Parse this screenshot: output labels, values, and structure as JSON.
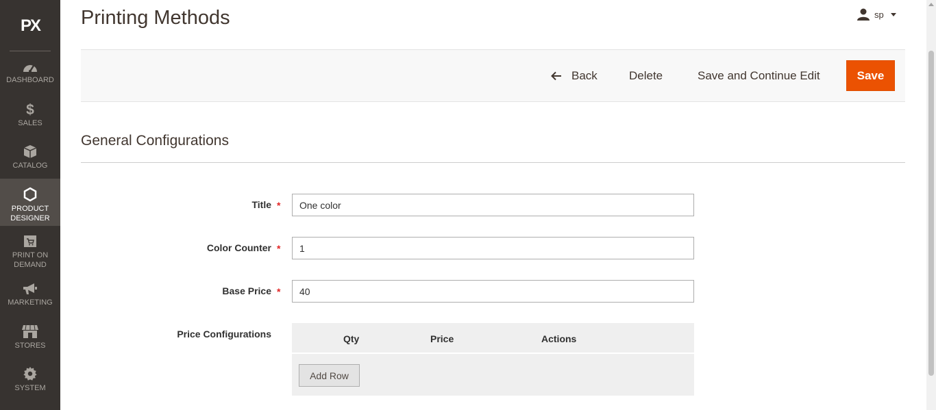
{
  "sidebar": {
    "logo": "PX",
    "items": [
      {
        "label": "DASHBOARD",
        "icon": "gauge-icon"
      },
      {
        "label": "SALES",
        "icon": "dollar-icon"
      },
      {
        "label": "CATALOG",
        "icon": "box-icon"
      },
      {
        "label": "PRODUCT DESIGNER",
        "icon": "hexagon-icon",
        "active": true
      },
      {
        "label": "PRINT ON DEMAND",
        "icon": "cart-icon"
      },
      {
        "label": "MARKETING",
        "icon": "megaphone-icon"
      },
      {
        "label": "STORES",
        "icon": "storefront-icon"
      },
      {
        "label": "SYSTEM",
        "icon": "gear-icon"
      }
    ]
  },
  "header": {
    "title": "Printing Methods",
    "user": "sp"
  },
  "toolbar": {
    "back_label": "Back",
    "delete_label": "Delete",
    "save_continue_label": "Save and Continue Edit",
    "save_label": "Save"
  },
  "section": {
    "title": "General Configurations"
  },
  "form": {
    "title_label": "Title",
    "title_value": "One color",
    "color_counter_label": "Color Counter",
    "color_counter_value": "1",
    "base_price_label": "Base Price",
    "base_price_value": "40",
    "price_config_label": "Price Configurations",
    "required_mark": "*"
  },
  "price_table": {
    "columns": [
      "Qty",
      "Price",
      "Actions"
    ],
    "add_row_label": "Add Row"
  },
  "colors": {
    "sidebar_bg": "#373330",
    "sidebar_active": "#524d49",
    "accent": "#eb5202"
  }
}
